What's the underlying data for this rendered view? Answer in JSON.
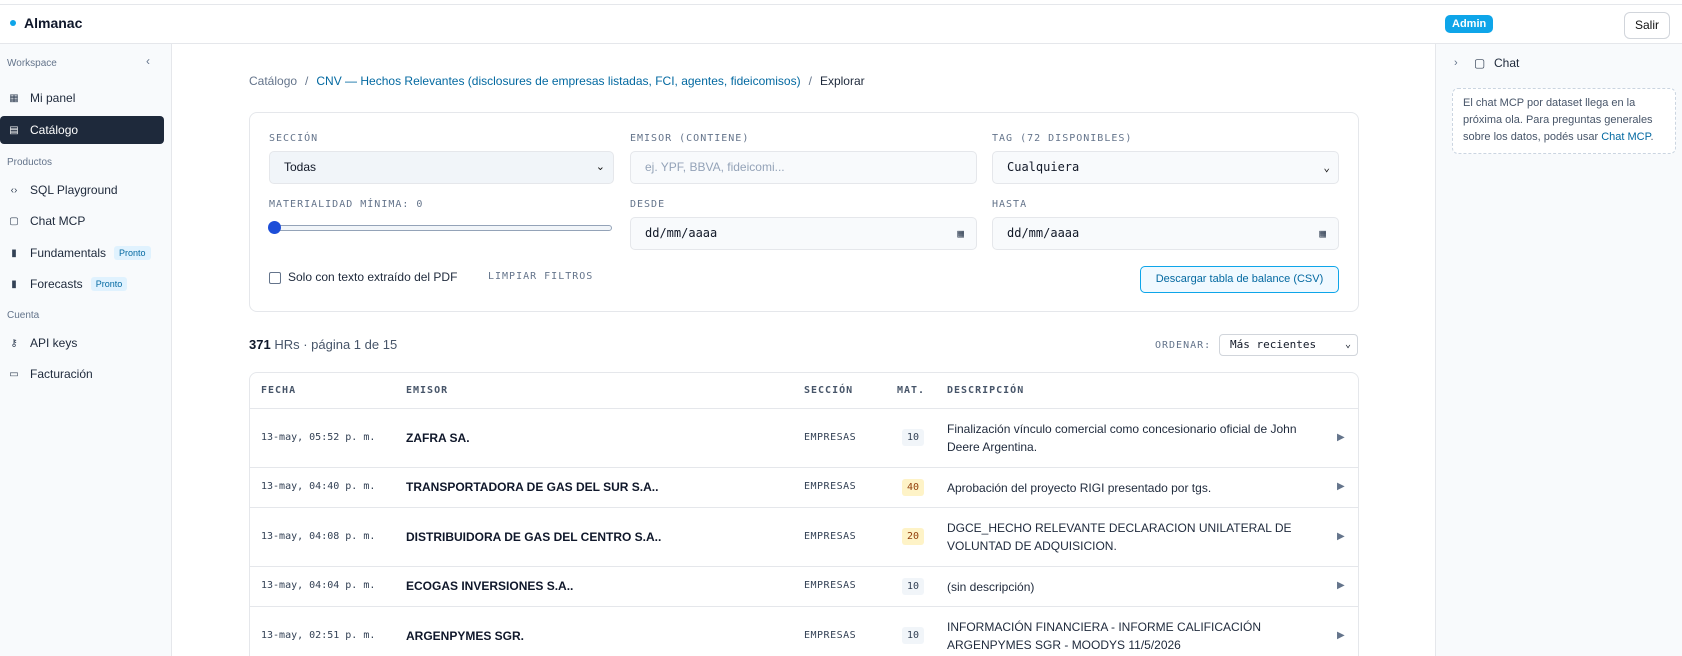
{
  "app": {
    "name": "Almanac",
    "admin_badge": "Admin",
    "logout": "Salir"
  },
  "sidebar": {
    "workspace_label": "Workspace",
    "collapse_icon": "chevron-left-icon",
    "items_workspace": [
      {
        "label": "Mi panel",
        "icon": "dashboard-icon"
      },
      {
        "label": "Catálogo",
        "icon": "catalog-icon",
        "active": true
      }
    ],
    "productos_label": "Productos",
    "items_productos": [
      {
        "label": "SQL Playground",
        "icon": "code-icon"
      },
      {
        "label": "Chat MCP",
        "icon": "chat-icon"
      },
      {
        "label": "Fundamentals",
        "icon": "bar-chart-icon",
        "badge": "Pronto"
      },
      {
        "label": "Forecasts",
        "icon": "bar-chart-icon",
        "badge": "Pronto"
      }
    ],
    "cuenta_label": "Cuenta",
    "items_cuenta": [
      {
        "label": "API keys",
        "icon": "key-icon"
      },
      {
        "label": "Facturación",
        "icon": "card-icon"
      }
    ]
  },
  "breadcrumb": {
    "root": "Catálogo",
    "dataset": "CNV — Hechos Relevantes (disclosures de empresas listadas, FCI, agentes, fideicomisos)",
    "current": "Explorar",
    "separator": "/"
  },
  "filters": {
    "seccion_label": "SECCIÓN",
    "seccion_value": "Todas",
    "emisor_label": "EMISOR (CONTIENE)",
    "emisor_placeholder": "ej. YPF, BBVA, fideicomi...",
    "tag_label": "TAG (72 DISPONIBLES)",
    "tag_value": "Cualquiera",
    "materialidad_label": "MATERIALIDAD MÍNIMA: 0",
    "materialidad_value": 0,
    "desde_label": "DESDE",
    "desde_value": "dd/mm/aaaa",
    "hasta_label": "HASTA",
    "hasta_value": "dd/mm/aaaa",
    "solo_texto_label": "Solo con texto extraído del PDF",
    "solo_texto_checked": false,
    "clear_label": "LIMPIAR FILTROS",
    "csv_label": "Descargar tabla de balance (CSV)"
  },
  "results": {
    "count": "371",
    "count_suffix": "HRs · página 1 de 15",
    "order_label": "ORDENAR:",
    "order_value": "Más recientes"
  },
  "table": {
    "headers": {
      "fecha": "FECHA",
      "emisor": "EMISOR",
      "seccion": "SECCIÓN",
      "mat": "MAT.",
      "descripcion": "DESCRIPCIÓN"
    },
    "rows": [
      {
        "fecha": "13-may, 05:52 p. m.",
        "emisor": "ZAFRA SA.",
        "seccion": "EMPRESAS",
        "mat": "10",
        "descripcion": "Finalización vínculo comercial como concesionario oficial de John Deere Argentina."
      },
      {
        "fecha": "13-may, 04:40 p. m.",
        "emisor": "TRANSPORTADORA DE GAS DEL SUR S.A..",
        "seccion": "EMPRESAS",
        "mat": "40",
        "descripcion": "Aprobación del proyecto RIGI presentado por tgs."
      },
      {
        "fecha": "13-may, 04:08 p. m.",
        "emisor": "DISTRIBUIDORA DE GAS DEL CENTRO S.A..",
        "seccion": "EMPRESAS",
        "mat": "20",
        "descripcion": "DGCE_HECHO RELEVANTE DECLARACION UNILATERAL DE VOLUNTAD DE ADQUISICION."
      },
      {
        "fecha": "13-may, 04:04 p. m.",
        "emisor": "ECOGAS INVERSIONES S.A..",
        "seccion": "EMPRESAS",
        "mat": "10",
        "descripcion": "(sin descripción)"
      },
      {
        "fecha": "13-may, 02:51 p. m.",
        "emisor": "ARGENPYMES SGR.",
        "seccion": "EMPRESAS",
        "mat": "10",
        "descripcion": "INFORMACIÓN FINANCIERA - INFORME CALIFICACIÓN ARGENPYMES SGR - MOODYS 11/5/2026"
      }
    ]
  },
  "chat_panel": {
    "title": "Chat",
    "text_before": "El chat MCP por dataset llega en la próxima ola. Para preguntas generales sobre los datos, podés usar ",
    "link": "Chat MCP",
    "text_after": "."
  },
  "colors": {
    "accent": "#0ea5e9",
    "active_nav": "#1e293b",
    "link": "#0369a1",
    "badge_bg": "#e0f2fe",
    "mat_warn": "#fef3c7"
  }
}
